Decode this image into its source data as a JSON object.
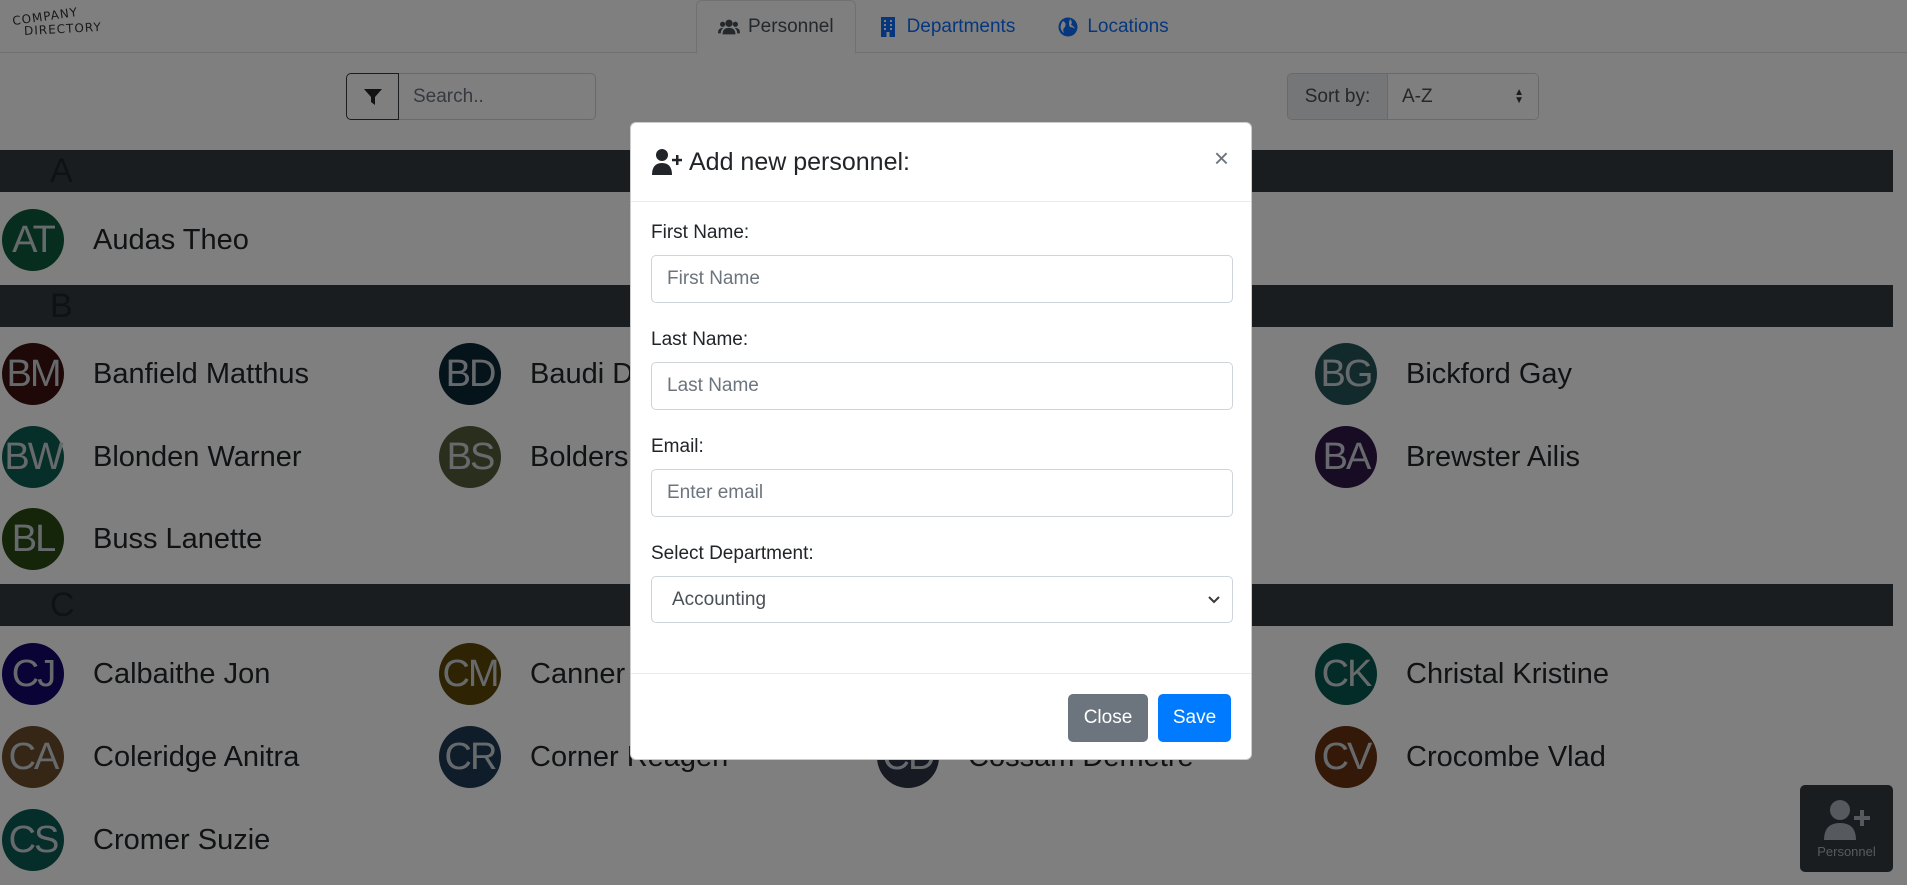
{
  "logo": {
    "line1": "COMPANY",
    "line2": "DIRECTORY"
  },
  "tabs": [
    {
      "label": "Personnel",
      "icon": "users-icon",
      "active": true
    },
    {
      "label": "Departments",
      "icon": "building-icon",
      "active": false
    },
    {
      "label": "Locations",
      "icon": "globe-icon",
      "active": false
    }
  ],
  "search": {
    "placeholder": "Search.."
  },
  "sort": {
    "label": "Sort by:",
    "value": "A-Z"
  },
  "sections": [
    {
      "letter": "A",
      "people": [
        {
          "initials": "AT",
          "name": "Audas Theo",
          "color": "#0e5a3c"
        }
      ]
    },
    {
      "letter": "B",
      "people": [
        {
          "initials": "BM",
          "name": "Banfield Matthus",
          "color": "#3d1010"
        },
        {
          "initials": "BD",
          "name": "Baudi D",
          "color": "#0a2636"
        },
        {
          "initials": "BG",
          "name": "Bickford Gay",
          "color": "#26545a"
        },
        {
          "initials": "BW",
          "name": "Blonden Warner",
          "color": "#0d5e52"
        },
        {
          "initials": "BS",
          "name": "Bolders",
          "color": "#545e3a"
        },
        {
          "initials": "BA",
          "name": "Brewster Ailis",
          "color": "#31184a"
        },
        {
          "initials": "BL",
          "name": "Buss Lanette",
          "color": "#2b4a12"
        }
      ]
    },
    {
      "letter": "C",
      "people": [
        {
          "initials": "CJ",
          "name": "Calbaithe Jon",
          "color": "#14066b"
        },
        {
          "initials": "CM",
          "name": "Canner",
          "color": "#5c4806"
        },
        {
          "initials": "CK",
          "name": "Christal Kristine",
          "color": "#07574e"
        },
        {
          "initials": "CA",
          "name": "Coleridge Anitra",
          "color": "#6b4d2c"
        },
        {
          "initials": "CR",
          "name": "Corner Reagen",
          "color": "#1c3a52"
        },
        {
          "initials": "CD",
          "name": "Cossam Demetre",
          "color": "#2e3445"
        },
        {
          "initials": "CV",
          "name": "Crocombe Vlad",
          "color": "#6b3210"
        },
        {
          "initials": "CS",
          "name": "Cromer Suzie",
          "color": "#0b5b55"
        }
      ]
    }
  ],
  "fab": {
    "label": "Personnel"
  },
  "modal": {
    "title": "Add new personnel:",
    "close_symbol": "×",
    "first_name": {
      "label": "First Name:",
      "placeholder": "First Name",
      "value": ""
    },
    "last_name": {
      "label": "Last Name:",
      "placeholder": "Last Name",
      "value": ""
    },
    "email": {
      "label": "Email:",
      "placeholder": "Enter email",
      "value": ""
    },
    "department": {
      "label": "Select Department:",
      "value": "Accounting"
    },
    "close_label": "Close",
    "save_label": "Save"
  }
}
